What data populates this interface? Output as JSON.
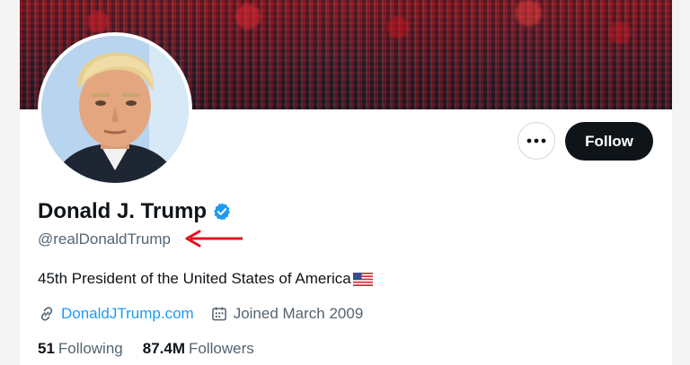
{
  "profile": {
    "name": "Donald J. Trump",
    "handle": "@realDonaldTrump",
    "bio": "45th President of the United States of America",
    "website": "DonaldJTrump.com",
    "joined": "Joined March 2009",
    "following_count": "51",
    "following_label": "Following",
    "followers_count": "87.4M",
    "followers_label": "Followers"
  },
  "actions": {
    "follow_label": "Follow",
    "more_label": "•••"
  },
  "icons": {
    "verified": "verified-badge-icon",
    "flag": "us-flag-icon",
    "link": "link-icon",
    "calendar": "calendar-icon",
    "annotation": "red-arrow-icon"
  },
  "colors": {
    "accent": "#1d9bf0",
    "follow_bg": "#0f1419",
    "annotation": "#e0141e",
    "secondary_text": "#536471"
  }
}
